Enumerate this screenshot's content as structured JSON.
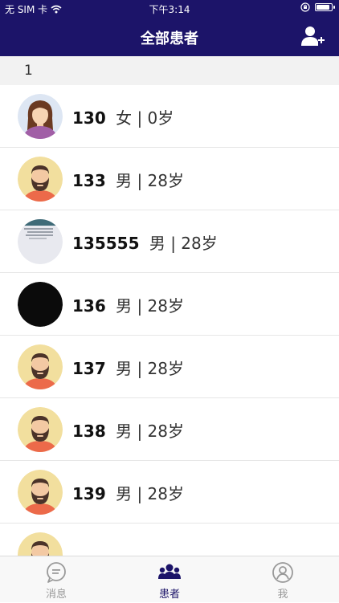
{
  "status_bar": {
    "carrier": "无 SIM 卡",
    "time": "下午3:14",
    "battery_level": 0.9
  },
  "nav": {
    "title": "全部患者"
  },
  "section": {
    "header": "1"
  },
  "patients": [
    {
      "number": "130",
      "info": "女 | 0岁",
      "avatar": "female-avatar"
    },
    {
      "number": "133",
      "info": "男 | 28岁",
      "avatar": "male-avatar"
    },
    {
      "number": "135555",
      "info": "男 | 28岁",
      "avatar": "photo-avatar"
    },
    {
      "number": "136",
      "info": "男 | 28岁",
      "avatar": "black-avatar"
    },
    {
      "number": "137",
      "info": "男 | 28岁",
      "avatar": "male-avatar"
    },
    {
      "number": "138",
      "info": "男 | 28岁",
      "avatar": "male-avatar"
    },
    {
      "number": "139",
      "info": "男 | 28岁",
      "avatar": "male-avatar"
    }
  ],
  "tabs": [
    {
      "label": "消息",
      "icon": "message-icon"
    },
    {
      "label": "患者",
      "icon": "patients-icon",
      "active": true
    },
    {
      "label": "我",
      "icon": "profile-icon"
    }
  ],
  "colors": {
    "brand": "#1c1469",
    "inactive": "#999999",
    "separator": "#e6e6e6"
  }
}
